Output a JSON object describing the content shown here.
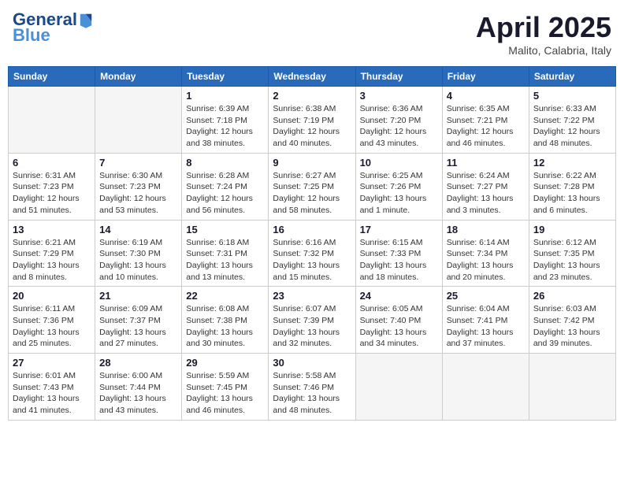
{
  "header": {
    "logo": {
      "general": "General",
      "blue": "Blue"
    },
    "month_title": "April 2025",
    "location": "Malito, Calabria, Italy"
  },
  "weekdays": [
    "Sunday",
    "Monday",
    "Tuesday",
    "Wednesday",
    "Thursday",
    "Friday",
    "Saturday"
  ],
  "weeks": [
    [
      {
        "day": null
      },
      {
        "day": null
      },
      {
        "day": 1,
        "sunrise": "6:39 AM",
        "sunset": "7:18 PM",
        "daylight": "12 hours and 38 minutes."
      },
      {
        "day": 2,
        "sunrise": "6:38 AM",
        "sunset": "7:19 PM",
        "daylight": "12 hours and 40 minutes."
      },
      {
        "day": 3,
        "sunrise": "6:36 AM",
        "sunset": "7:20 PM",
        "daylight": "12 hours and 43 minutes."
      },
      {
        "day": 4,
        "sunrise": "6:35 AM",
        "sunset": "7:21 PM",
        "daylight": "12 hours and 46 minutes."
      },
      {
        "day": 5,
        "sunrise": "6:33 AM",
        "sunset": "7:22 PM",
        "daylight": "12 hours and 48 minutes."
      }
    ],
    [
      {
        "day": 6,
        "sunrise": "6:31 AM",
        "sunset": "7:23 PM",
        "daylight": "12 hours and 51 minutes."
      },
      {
        "day": 7,
        "sunrise": "6:30 AM",
        "sunset": "7:23 PM",
        "daylight": "12 hours and 53 minutes."
      },
      {
        "day": 8,
        "sunrise": "6:28 AM",
        "sunset": "7:24 PM",
        "daylight": "12 hours and 56 minutes."
      },
      {
        "day": 9,
        "sunrise": "6:27 AM",
        "sunset": "7:25 PM",
        "daylight": "12 hours and 58 minutes."
      },
      {
        "day": 10,
        "sunrise": "6:25 AM",
        "sunset": "7:26 PM",
        "daylight": "13 hours and 1 minute."
      },
      {
        "day": 11,
        "sunrise": "6:24 AM",
        "sunset": "7:27 PM",
        "daylight": "13 hours and 3 minutes."
      },
      {
        "day": 12,
        "sunrise": "6:22 AM",
        "sunset": "7:28 PM",
        "daylight": "13 hours and 6 minutes."
      }
    ],
    [
      {
        "day": 13,
        "sunrise": "6:21 AM",
        "sunset": "7:29 PM",
        "daylight": "13 hours and 8 minutes."
      },
      {
        "day": 14,
        "sunrise": "6:19 AM",
        "sunset": "7:30 PM",
        "daylight": "13 hours and 10 minutes."
      },
      {
        "day": 15,
        "sunrise": "6:18 AM",
        "sunset": "7:31 PM",
        "daylight": "13 hours and 13 minutes."
      },
      {
        "day": 16,
        "sunrise": "6:16 AM",
        "sunset": "7:32 PM",
        "daylight": "13 hours and 15 minutes."
      },
      {
        "day": 17,
        "sunrise": "6:15 AM",
        "sunset": "7:33 PM",
        "daylight": "13 hours and 18 minutes."
      },
      {
        "day": 18,
        "sunrise": "6:14 AM",
        "sunset": "7:34 PM",
        "daylight": "13 hours and 20 minutes."
      },
      {
        "day": 19,
        "sunrise": "6:12 AM",
        "sunset": "7:35 PM",
        "daylight": "13 hours and 23 minutes."
      }
    ],
    [
      {
        "day": 20,
        "sunrise": "6:11 AM",
        "sunset": "7:36 PM",
        "daylight": "13 hours and 25 minutes."
      },
      {
        "day": 21,
        "sunrise": "6:09 AM",
        "sunset": "7:37 PM",
        "daylight": "13 hours and 27 minutes."
      },
      {
        "day": 22,
        "sunrise": "6:08 AM",
        "sunset": "7:38 PM",
        "daylight": "13 hours and 30 minutes."
      },
      {
        "day": 23,
        "sunrise": "6:07 AM",
        "sunset": "7:39 PM",
        "daylight": "13 hours and 32 minutes."
      },
      {
        "day": 24,
        "sunrise": "6:05 AM",
        "sunset": "7:40 PM",
        "daylight": "13 hours and 34 minutes."
      },
      {
        "day": 25,
        "sunrise": "6:04 AM",
        "sunset": "7:41 PM",
        "daylight": "13 hours and 37 minutes."
      },
      {
        "day": 26,
        "sunrise": "6:03 AM",
        "sunset": "7:42 PM",
        "daylight": "13 hours and 39 minutes."
      }
    ],
    [
      {
        "day": 27,
        "sunrise": "6:01 AM",
        "sunset": "7:43 PM",
        "daylight": "13 hours and 41 minutes."
      },
      {
        "day": 28,
        "sunrise": "6:00 AM",
        "sunset": "7:44 PM",
        "daylight": "13 hours and 43 minutes."
      },
      {
        "day": 29,
        "sunrise": "5:59 AM",
        "sunset": "7:45 PM",
        "daylight": "13 hours and 46 minutes."
      },
      {
        "day": 30,
        "sunrise": "5:58 AM",
        "sunset": "7:46 PM",
        "daylight": "13 hours and 48 minutes."
      },
      {
        "day": null
      },
      {
        "day": null
      },
      {
        "day": null
      }
    ]
  ],
  "labels": {
    "sunrise": "Sunrise:",
    "sunset": "Sunset:",
    "daylight": "Daylight:"
  }
}
